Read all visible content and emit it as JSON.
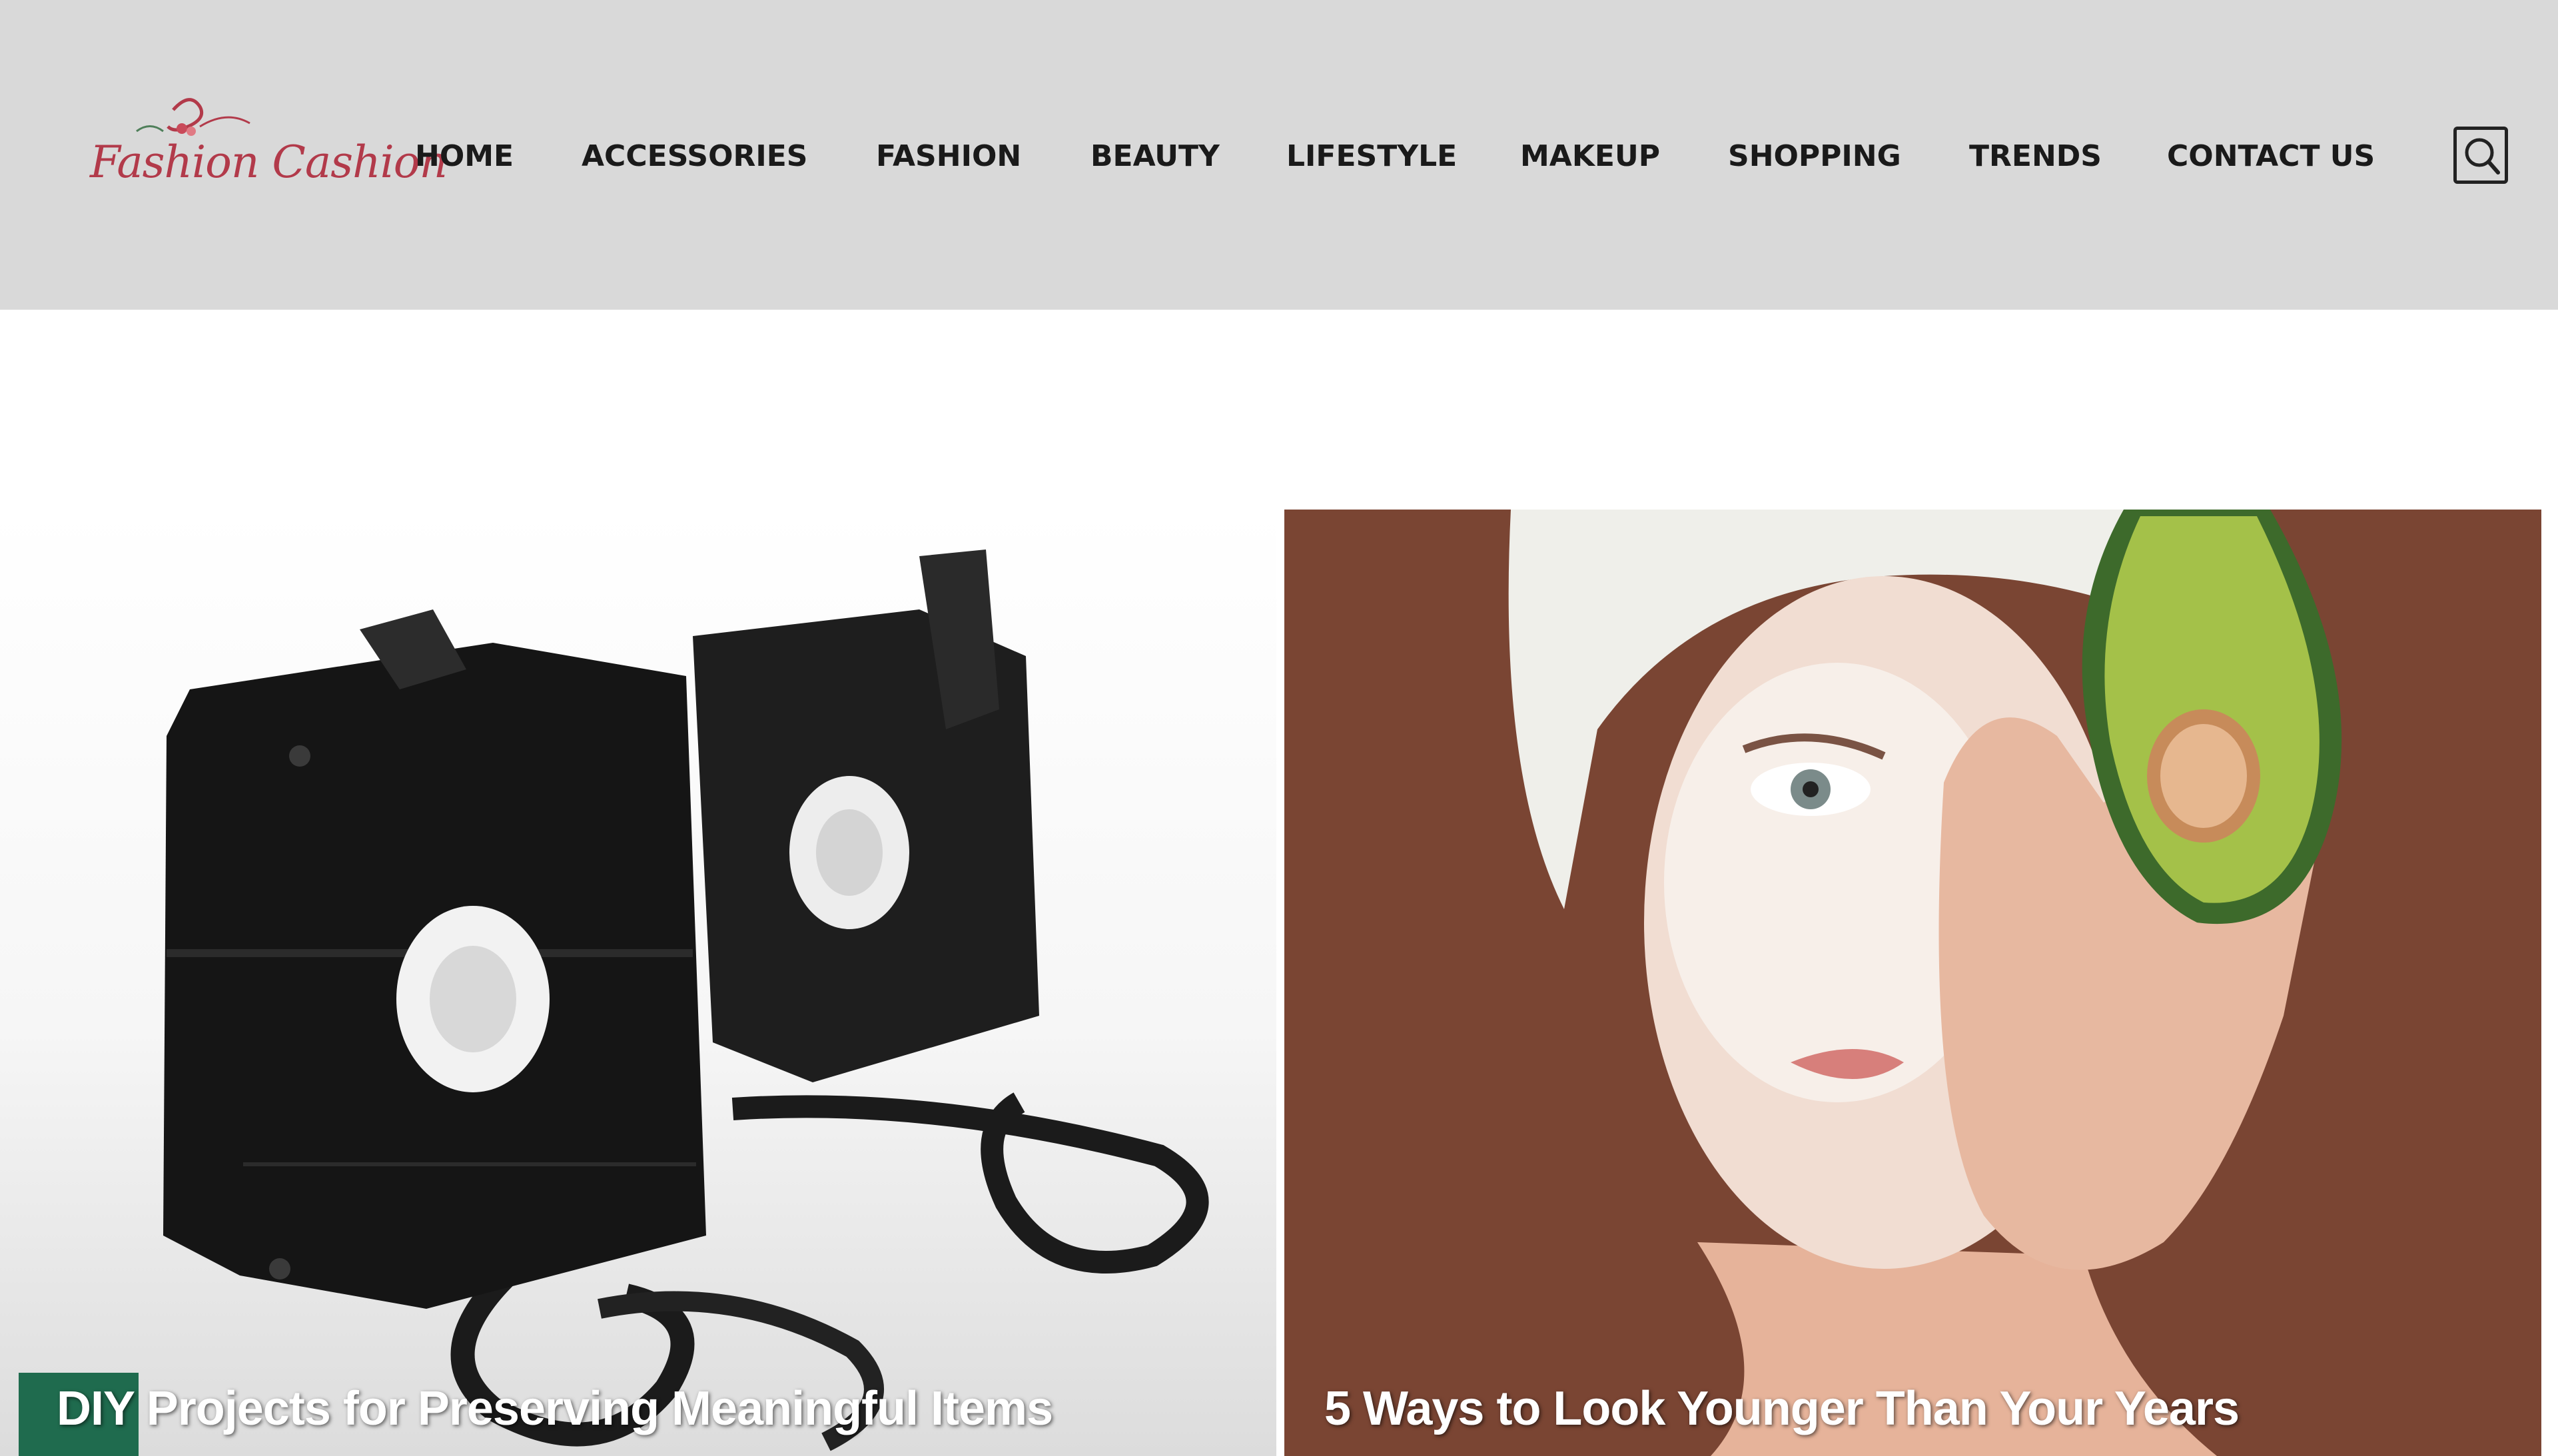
{
  "brand": {
    "logo_text": "Fashion Cashion",
    "accent": "#b23a4a"
  },
  "header": {
    "background": "#d9d9d9"
  },
  "nav": {
    "items": [
      {
        "label": "HOME"
      },
      {
        "label": "ACCESSORIES"
      },
      {
        "label": "FASHION"
      },
      {
        "label": "BEAUTY"
      },
      {
        "label": "LIFESTYLE"
      },
      {
        "label": "MAKEUP"
      },
      {
        "label": "SHOPPING"
      },
      {
        "label": "TRENDS"
      },
      {
        "label": "CONTACT US"
      }
    ]
  },
  "search": {
    "icon": "search-icon"
  },
  "featured": [
    {
      "title": "DIY Projects for Preserving Meaningful Items",
      "badge_color": "#1f6b4e",
      "image": "vhs-cassette-tape-image"
    },
    {
      "title": "5 Ways to Look Younger Than Your Years",
      "image": "avocado-face-mask-image"
    }
  ]
}
